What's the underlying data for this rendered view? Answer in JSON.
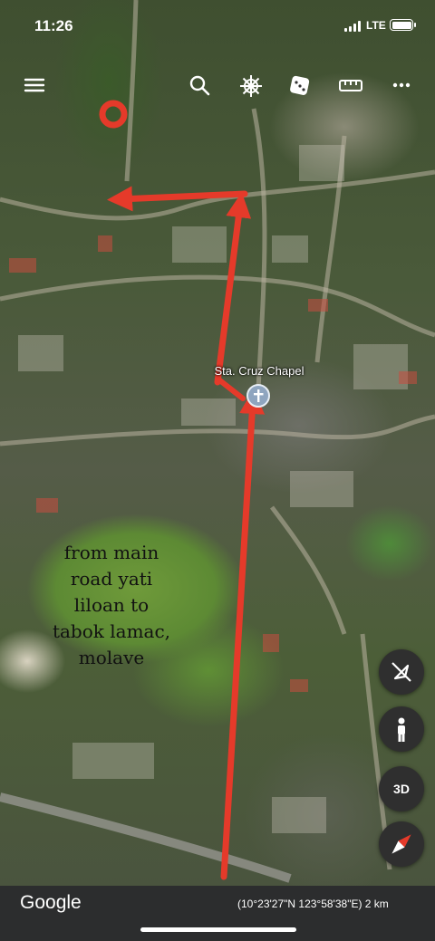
{
  "status_bar": {
    "time": "11:26",
    "network": "LTE",
    "icons": [
      "signal-bars-icon",
      "battery-icon"
    ]
  },
  "toolbar": {
    "icons": [
      "menu-icon",
      "search-icon",
      "voyager-helm-icon",
      "random-dice-icon",
      "measure-ruler-icon",
      "more-icon"
    ]
  },
  "map": {
    "place_label": "Sta. Cruz Chapel",
    "place_icon": "chapel-pin-icon",
    "annotation_lines": [
      "from main",
      "road yati",
      "liloan to",
      "tabok lamac,",
      "molave"
    ],
    "marker_color": "#e53a2a",
    "arrow_color": "#e53a2a",
    "marker_icon": "circle-marker-icon",
    "arrow_icons": [
      "arrow-up-main-icon",
      "arrow-up-branch-icon",
      "arrow-left-icon",
      "arrow-to-chapel-icon"
    ]
  },
  "controls": {
    "three_d_label": "3D",
    "icons": [
      "no-tilt-icon",
      "pegman-icon",
      "compass-icon"
    ]
  },
  "footer": {
    "brand": "Google",
    "coordinates": "(10°23'27\"N 123°58'38\"E) 2 km"
  }
}
